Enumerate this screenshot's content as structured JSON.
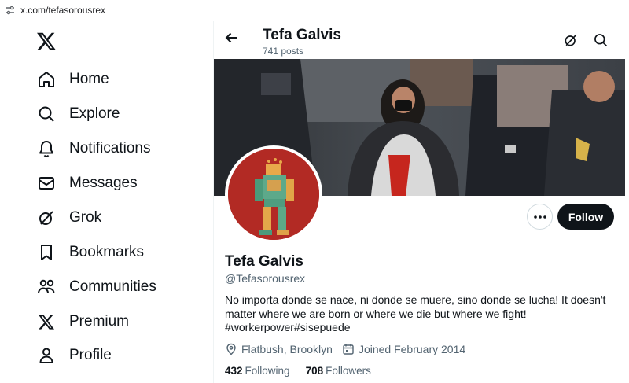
{
  "browser": {
    "url": "x.com/tefasorousrex"
  },
  "sidebar": {
    "items": [
      {
        "label": "Home",
        "icon": "home-icon"
      },
      {
        "label": "Explore",
        "icon": "search-icon"
      },
      {
        "label": "Notifications",
        "icon": "bell-icon"
      },
      {
        "label": "Messages",
        "icon": "envelope-icon"
      },
      {
        "label": "Grok",
        "icon": "grok-icon"
      },
      {
        "label": "Bookmarks",
        "icon": "bookmark-icon"
      },
      {
        "label": "Communities",
        "icon": "people-icon"
      },
      {
        "label": "Premium",
        "icon": "x-logo-icon"
      },
      {
        "label": "Profile",
        "icon": "person-icon"
      }
    ]
  },
  "header": {
    "name": "Tefa Galvis",
    "posts": "741 posts"
  },
  "profile": {
    "name": "Tefa Galvis",
    "handle": "@Tefasorousrex",
    "follow_label": "Follow",
    "bio_line1": "No importa donde se nace, ni donde se muere, sino donde se lucha! It doesn't",
    "bio_line2": "matter where we are born or where we die but where we fight!",
    "bio_line3": "#workerpower#sisepuede",
    "location": "Flatbush, Brooklyn",
    "joined": "Joined February 2014",
    "following_count": "432",
    "following_label": "Following",
    "followers_count": "708",
    "followers_label": "Followers"
  },
  "colors": {
    "avatar_bg": "#b22a24",
    "follow_bg": "#0f1419",
    "muted": "#536471"
  }
}
